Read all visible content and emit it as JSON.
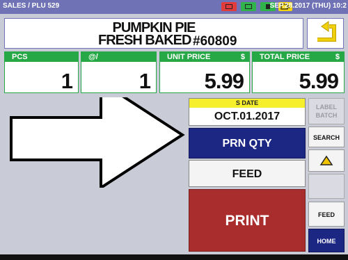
{
  "status_bar": {
    "mode_text": "SALES / PLU 529",
    "datetime": "SEP.28.2017 (THU) 10:2"
  },
  "item": {
    "name_line1": "PUMPKIN PIE",
    "name_line2": "FRESH BAKED",
    "plu_number": "#60809"
  },
  "fields": {
    "pcs": {
      "label": "PCS",
      "value": "1"
    },
    "at": {
      "label": "@/",
      "value": "1"
    },
    "unit_price": {
      "label": "UNIT PRICE",
      "currency": "$",
      "value": "5.99"
    },
    "total_price": {
      "label": "TOTAL PRICE",
      "currency": "$",
      "value": "5.99"
    }
  },
  "sell_date": {
    "label": "S DATE",
    "value": "OCT.01.2017"
  },
  "buttons": {
    "prn_qty": "PRN QTY",
    "feed_main": "FEED",
    "print": "PRINT",
    "label_batch_line1": "LABEL",
    "label_batch_line2": "BATCH",
    "search": "SEARCH",
    "feed_side": "FEED",
    "home": "HOME"
  },
  "icons": {
    "back": "return-arrow-icon",
    "up": "up-triangle-icon",
    "annotation": "right-arrow-callout-icon"
  },
  "colors": {
    "status_bar": "#6f73b6",
    "field_header": "#27a846",
    "prn_qty_bg": "#1c2784",
    "print_bg": "#a92d2d",
    "sdate_label_bg": "#f6ef2b",
    "up_arrow_fill": "#f2c400"
  }
}
